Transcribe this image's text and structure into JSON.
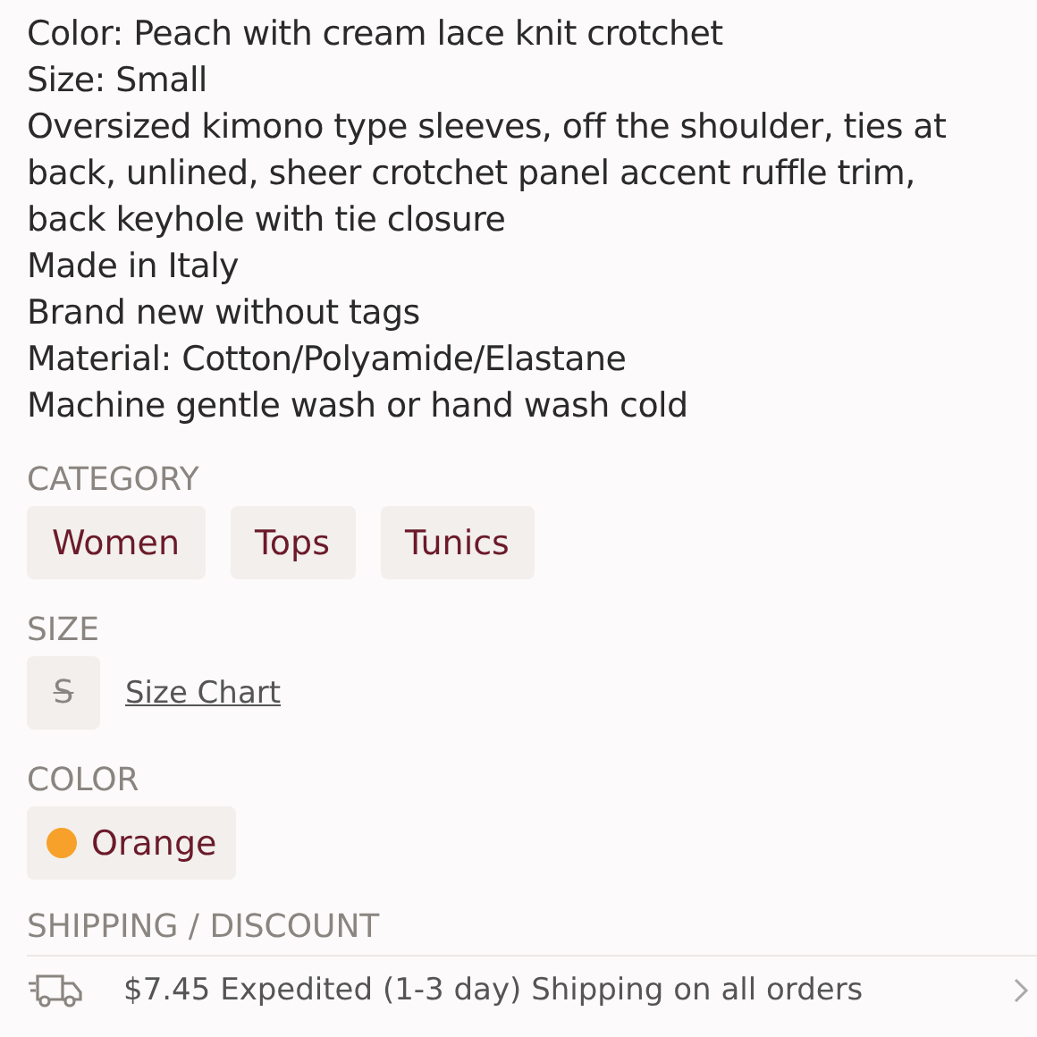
{
  "description": [
    "Color: Peach with cream lace knit crotchet",
    "Size: Small",
    "Oversized kimono type sleeves, off the shoulder, ties at back, unlined, sheer crotchet panel accent ruffle trim, back keyhole with tie closure",
    "Made in Italy",
    "Brand new without tags",
    "Material: Cotton/Polyamide/Elastane",
    "Machine gentle wash or hand wash cold"
  ],
  "category": {
    "heading": "CATEGORY",
    "tags": [
      "Women",
      "Tops",
      "Tunics"
    ]
  },
  "size": {
    "heading": "SIZE",
    "value": "S",
    "disabled": true,
    "link": "Size Chart"
  },
  "color": {
    "heading": "COLOR",
    "name": "Orange",
    "color": "#f7a12a"
  },
  "shipping": {
    "heading": "SHIPPING / DISCOUNT",
    "text": "$7.45 Expedited (1-3 day) Shipping on all orders"
  }
}
